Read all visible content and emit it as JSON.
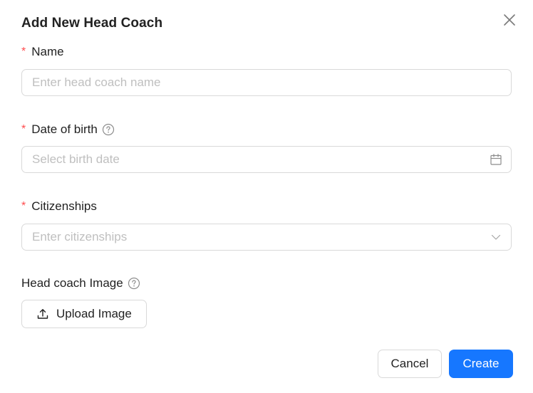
{
  "modal": {
    "title": "Add New Head Coach"
  },
  "fields": {
    "name": {
      "required_mark": "*",
      "label": "Name",
      "placeholder": "Enter head coach name",
      "value": ""
    },
    "dob": {
      "required_mark": "*",
      "label": "Date of birth",
      "placeholder": "Select birth date",
      "value": "",
      "help_icon": "question-circle-icon",
      "suffix_icon": "calendar-icon"
    },
    "citizenships": {
      "required_mark": "*",
      "label": "Citizenships",
      "placeholder": "Enter citizenships",
      "value": "",
      "suffix_icon": "chevron-down-icon"
    },
    "image": {
      "label": "Head coach Image",
      "help_icon": "question-circle-icon",
      "upload_label": "Upload Image",
      "upload_icon": "upload-icon"
    }
  },
  "footer": {
    "cancel_label": "Cancel",
    "create_label": "Create"
  },
  "colors": {
    "primary": "#1677ff",
    "required": "#ff4d4f",
    "border": "#d9d9d9",
    "placeholder": "#bfbfbf"
  }
}
